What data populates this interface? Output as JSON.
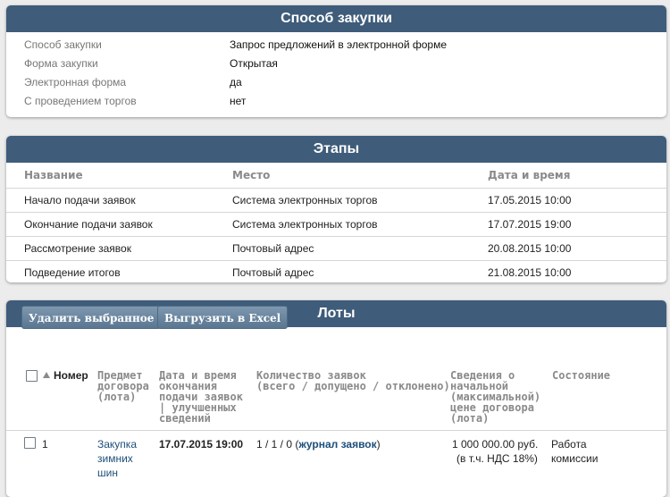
{
  "procurement": {
    "title": "Способ закупки",
    "rows": [
      {
        "label": "Способ закупки",
        "value": "Запрос предложений в электронной форме"
      },
      {
        "label": "Форма закупки",
        "value": "Открытая"
      },
      {
        "label": "Электронная форма",
        "value": "да"
      },
      {
        "label": "С проведением торгов",
        "value": "нет"
      }
    ]
  },
  "stages": {
    "title": "Этапы",
    "columns": [
      "Название",
      "Место",
      "Дата и время"
    ],
    "rows": [
      {
        "name": "Начало подачи заявок",
        "place": "Система электронных торгов",
        "datetime": "17.05.2015 10:00"
      },
      {
        "name": "Окончание подачи заявок",
        "place": "Система электронных торгов",
        "datetime": "17.07.2015 19:00"
      },
      {
        "name": "Рассмотрение заявок",
        "place": "Почтовый адрес",
        "datetime": "20.08.2015 10:00"
      },
      {
        "name": "Подведение итогов",
        "place": "Почтовый адрес",
        "datetime": "21.08.2015 10:00"
      }
    ]
  },
  "lots": {
    "title": "Лоты",
    "buttons": {
      "delete_selected": "Удалить выбранное",
      "export_excel": "Выгрузить в Excel"
    },
    "columns": {
      "number": "Номер",
      "subject": "Предмет\nдоговора\n(лота)",
      "deadline": "Дата и время\nокончания\nподачи заявок\n| улучшенных\nсведений",
      "applications": "Количество заявок\n(всего / допущено / отклонено)",
      "price": "Сведения о\nначальной\n(максимальной)\nцене договора\n(лота)",
      "status": "Состояние"
    },
    "rows": [
      {
        "number": "1",
        "subject": "Закупка зимних шин",
        "deadline": "17.07.2015 19:00",
        "applications_counts": "1 / 1 / 0 (",
        "applications_link": "журнал заявок",
        "applications_close": ")",
        "price": "1 000 000.00 руб.",
        "vat": "(в т.ч. НДС 18%)",
        "status": "Работа комиссии"
      }
    ]
  },
  "colors": {
    "header_bg": "#3f5c7a",
    "button_bg": "#6c87a0",
    "link": "#1d4e7a"
  }
}
